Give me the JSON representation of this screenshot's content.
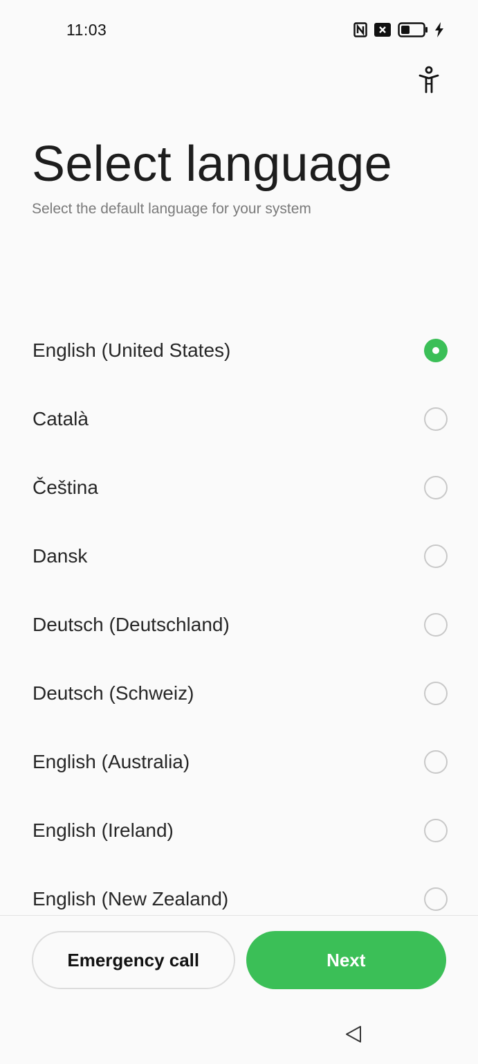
{
  "status_bar": {
    "time": "11:03",
    "icons": [
      "nfc-icon",
      "notification-x-icon",
      "battery-icon",
      "charging-bolt-icon"
    ]
  },
  "header": {
    "accessibility_icon": "accessibility-icon",
    "title": "Select language",
    "subtitle": "Select the default language for your system"
  },
  "languages": [
    {
      "label": "English (United States)",
      "selected": true
    },
    {
      "label": "Català",
      "selected": false
    },
    {
      "label": "Čeština",
      "selected": false
    },
    {
      "label": "Dansk",
      "selected": false
    },
    {
      "label": "Deutsch (Deutschland)",
      "selected": false
    },
    {
      "label": "Deutsch (Schweiz)",
      "selected": false
    },
    {
      "label": "English (Australia)",
      "selected": false
    },
    {
      "label": "English (Ireland)",
      "selected": false
    },
    {
      "label": "English (New Zealand)",
      "selected": false
    }
  ],
  "buttons": {
    "emergency_label": "Emergency call",
    "next_label": "Next"
  },
  "colors": {
    "accent": "#3bbf57",
    "background": "#fafafa",
    "subtitle": "#7a7a7a"
  },
  "nav_bar": {
    "back_icon": "back-triangle-icon"
  }
}
